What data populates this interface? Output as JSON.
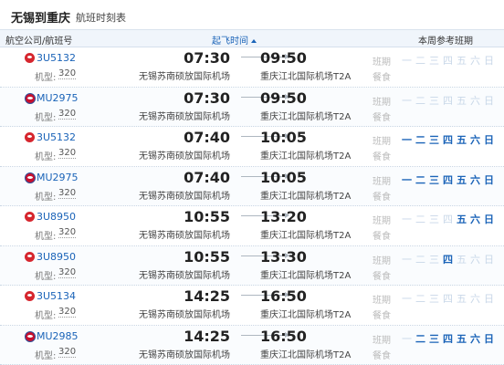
{
  "title": {
    "route": "无锡到重庆",
    "subtitle": "航班时刻表"
  },
  "header": {
    "airline_col": "航空公司/航班号",
    "dep_col": "起飞时间",
    "week_col": "本周参考班期"
  },
  "labels": {
    "model": "机型:",
    "ban": "班期",
    "meal": "餐食"
  },
  "colors": {
    "accent": "#1a63b8",
    "off_day": "#c8d7e8"
  },
  "weekdays": [
    "一",
    "二",
    "三",
    "四",
    "五",
    "六",
    "日"
  ],
  "flights": [
    {
      "logo": "3u-logo-icon",
      "flight_no": "3U5132",
      "model": "320",
      "dep_time": "07:30",
      "dep_airport": "无锡苏南硕放国际机场",
      "arr_time": "09:50",
      "arr_airport": "重庆江北国际机场T2A",
      "days": [
        0,
        0,
        0,
        0,
        0,
        0,
        0
      ]
    },
    {
      "logo": "mu-logo-icon",
      "flight_no": "MU2975",
      "model": "320",
      "dep_time": "07:30",
      "dep_airport": "无锡苏南硕放国际机场",
      "arr_time": "09:50",
      "arr_airport": "重庆江北国际机场T2A",
      "days": [
        0,
        0,
        0,
        0,
        0,
        0,
        0
      ]
    },
    {
      "logo": "3u-logo-icon",
      "flight_no": "3U5132",
      "model": "320",
      "dep_time": "07:40",
      "dep_airport": "无锡苏南硕放国际机场",
      "arr_time": "10:05",
      "arr_airport": "重庆江北国际机场T2A",
      "days": [
        1,
        1,
        1,
        1,
        1,
        1,
        1
      ]
    },
    {
      "logo": "mu-logo-icon",
      "flight_no": "MU2975",
      "model": "320",
      "dep_time": "07:40",
      "dep_airport": "无锡苏南硕放国际机场",
      "arr_time": "10:05",
      "arr_airport": "重庆江北国际机场T2A",
      "days": [
        1,
        1,
        1,
        1,
        1,
        1,
        1
      ]
    },
    {
      "logo": "3u-logo-icon",
      "flight_no": "3U8950",
      "model": "320",
      "dep_time": "10:55",
      "dep_airport": "无锡苏南硕放国际机场",
      "arr_time": "13:20",
      "arr_airport": "重庆江北国际机场T2A",
      "days": [
        0,
        0,
        0,
        0,
        1,
        1,
        1
      ]
    },
    {
      "logo": "3u-logo-icon",
      "flight_no": "3U8950",
      "model": "320",
      "dep_time": "10:55",
      "dep_airport": "无锡苏南硕放国际机场",
      "arr_time": "13:30",
      "arr_airport": "重庆江北国际机场T2A",
      "days": [
        0,
        0,
        0,
        1,
        0,
        0,
        0
      ]
    },
    {
      "logo": "3u-logo-icon",
      "flight_no": "3U5134",
      "model": "320",
      "dep_time": "14:25",
      "dep_airport": "无锡苏南硕放国际机场",
      "arr_time": "16:50",
      "arr_airport": "重庆江北国际机场T2A",
      "days": [
        0,
        0,
        0,
        0,
        0,
        0,
        0
      ]
    },
    {
      "logo": "mu-logo-icon",
      "flight_no": "MU2985",
      "model": "320",
      "dep_time": "14:25",
      "dep_airport": "无锡苏南硕放国际机场",
      "arr_time": "16:50",
      "arr_airport": "重庆江北国际机场T2A",
      "days": [
        0,
        1,
        1,
        1,
        1,
        1,
        1
      ]
    }
  ]
}
